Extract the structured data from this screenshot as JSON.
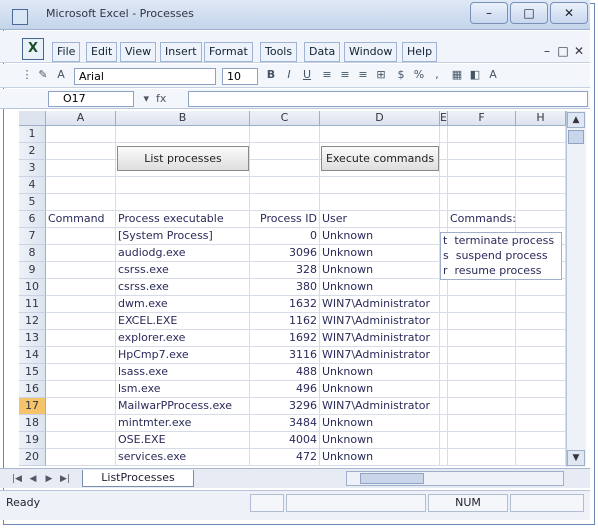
{
  "window": {
    "title": "Microsoft Excel - Processes"
  },
  "window_buttons": {
    "minimize": "–",
    "restore": "□",
    "close": "✕"
  },
  "menu": [
    {
      "label": "File",
      "style": "boxed"
    },
    {
      "label": "Edit",
      "style": "boxed"
    },
    {
      "label": "View",
      "style": "boxed"
    },
    {
      "label": "Insert",
      "style": "boxed"
    },
    {
      "label": "Format",
      "style": "boxed"
    },
    {
      "label": "Tools",
      "style": "boxed"
    },
    {
      "label": "Data",
      "style": "boxed"
    },
    {
      "label": "Window",
      "style": "boxed"
    },
    {
      "label": "Help",
      "style": "boxed"
    }
  ],
  "doc_controls": {
    "minimize": "–",
    "restore": "□",
    "close": "✕"
  },
  "toolbar": {
    "font": "Arial",
    "size": "10"
  },
  "formula_bar": {
    "name_box": "O17",
    "fx": "fx",
    "value": ""
  },
  "columns": [
    "A",
    "B",
    "C",
    "D",
    "E",
    "F"
  ],
  "rows": [
    "1",
    "2",
    "3",
    "4",
    "5",
    "6",
    "7",
    "8",
    "9",
    "10",
    "11",
    "12",
    "13",
    "14",
    "15",
    "16",
    "17",
    "18",
    "19",
    "20"
  ],
  "buttons": {
    "list_processes": "List processes",
    "execute_commands": "Execute commands"
  },
  "headers": {
    "command": "Command",
    "executable": "Process executable",
    "pid": "Process ID",
    "user": "User",
    "commands": "Commands:"
  },
  "processes": [
    {
      "exe": "[System Process]",
      "pid": "0",
      "user": "Unknown"
    },
    {
      "exe": "audiodg.exe",
      "pid": "3096",
      "user": "Unknown"
    },
    {
      "exe": "csrss.exe",
      "pid": "328",
      "user": "Unknown"
    },
    {
      "exe": "csrss.exe",
      "pid": "380",
      "user": "Unknown"
    },
    {
      "exe": "dwm.exe",
      "pid": "1632",
      "user": "WIN7\\Administrator"
    },
    {
      "exe": "EXCEL.EXE",
      "pid": "1162",
      "user": "WIN7\\Administrator"
    },
    {
      "exe": "explorer.exe",
      "pid": "1692",
      "user": "WIN7\\Administrator"
    },
    {
      "exe": "HpCmp7.exe",
      "pid": "3116",
      "user": "WIN7\\Administrator"
    },
    {
      "exe": "lsass.exe",
      "pid": "488",
      "user": "Unknown"
    },
    {
      "exe": "lsm.exe",
      "pid": "496",
      "user": "Unknown"
    },
    {
      "exe": "MailwarPProcess.exe",
      "pid": "3296",
      "user": "WIN7\\Administrator"
    },
    {
      "exe": "mintmter.exe",
      "pid": "3484",
      "user": "Unknown"
    },
    {
      "exe": "OSE.EXE",
      "pid": "4004",
      "user": "Unknown"
    },
    {
      "exe": "services.exe",
      "pid": "472",
      "user": "Unknown"
    }
  ],
  "commands": [
    {
      "key": "t",
      "desc": "terminate process"
    },
    {
      "key": "s",
      "desc": "suspend process"
    },
    {
      "key": "r",
      "desc": "resume process"
    }
  ],
  "sheet_tab": "ListProcesses",
  "status": {
    "ready": "Ready",
    "num": "NUM"
  }
}
